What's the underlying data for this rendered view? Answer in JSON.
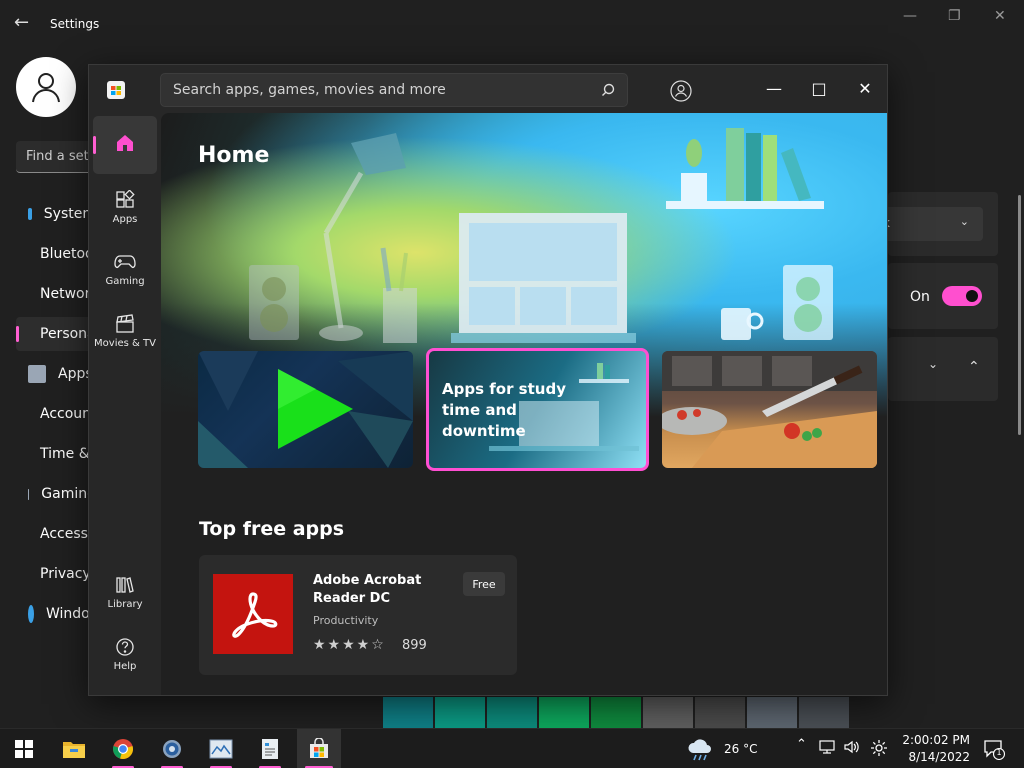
{
  "settings": {
    "title": "Settings",
    "search_placeholder": "Find a setting",
    "nav": [
      {
        "label": "System",
        "color": "#3aa0e6"
      },
      {
        "label": "Bluetooth & devices",
        "color": "#3aa0e6"
      },
      {
        "label": "Network & internet",
        "color": "#4fb1f0"
      },
      {
        "label": "Personalization",
        "color": "#f0a95a"
      },
      {
        "label": "Apps",
        "color": "#9aa6b5"
      },
      {
        "label": "Accounts",
        "color": "#39c08f"
      },
      {
        "label": "Time & language",
        "color": "#3aa0e6"
      },
      {
        "label": "Gaming",
        "color": "#9aa6b5"
      },
      {
        "label": "Accessibility",
        "color": "#3aa0e6"
      },
      {
        "label": "Privacy & security",
        "color": "#9aa6b5"
      },
      {
        "label": "Windows Update",
        "color": "#3aa0e6"
      }
    ],
    "dropdown_value": "k",
    "toggle_label": "On",
    "accent_color": "#ff4fcf",
    "swatches": [
      "#0f7f86",
      "#0b9a84",
      "#0c8b7c",
      "#0da85d",
      "#0f8a3e",
      "#5f5f5f",
      "#4b4b4b",
      "#5d6670",
      "#4a4f55"
    ]
  },
  "store": {
    "search_placeholder": "Search apps, games, movies and more",
    "rail": [
      {
        "label": ""
      },
      {
        "label": "Apps"
      },
      {
        "label": "Gaming"
      },
      {
        "label": "Movies & TV"
      },
      {
        "label": "Library"
      },
      {
        "label": "Help"
      }
    ],
    "hero": {
      "title": "Home",
      "cards": [
        {
          "caption": ""
        },
        {
          "caption": "Apps for study time and downtime"
        },
        {
          "caption": ""
        }
      ]
    },
    "top_free": {
      "title": "Top free apps",
      "apps": [
        {
          "name": "Adobe Acrobat Reader DC",
          "category": "Productivity",
          "rating": 4,
          "rating_count": "899",
          "price": "Free"
        }
      ]
    }
  },
  "taskbar": {
    "weather": "26 °C",
    "time": "2:00:02 PM",
    "date": "8/14/2022",
    "notification_count": "1"
  }
}
